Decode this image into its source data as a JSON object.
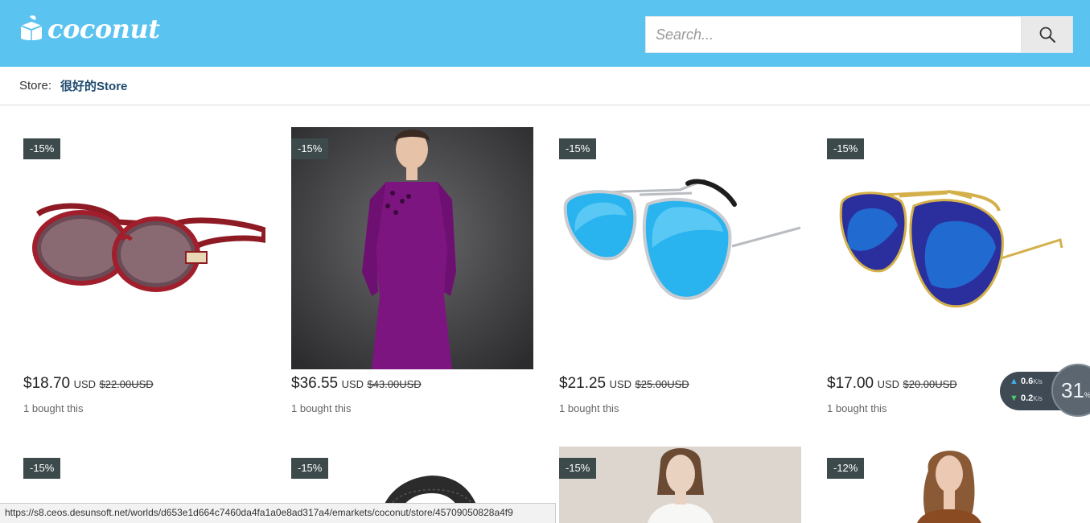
{
  "header": {
    "logo_text": "coconut",
    "search_placeholder": "Search..."
  },
  "store_bar": {
    "label": "Store:",
    "name": "很好的Store"
  },
  "products": [
    {
      "discount": "-15%",
      "price": "$18.70",
      "currency": "USD",
      "old_price": "$22.00USD",
      "bought": "1  bought this",
      "image": "red-sunglasses"
    },
    {
      "discount": "-15%",
      "price": "$36.55",
      "currency": "USD",
      "old_price": "$43.00USD",
      "bought": "1  bought this",
      "image": "purple-dress"
    },
    {
      "discount": "-15%",
      "price": "$21.25",
      "currency": "USD",
      "old_price": "$25.00USD",
      "bought": "1  bought this",
      "image": "blue-mirror-aviators"
    },
    {
      "discount": "-15%",
      "price": "$17.00",
      "currency": "USD",
      "old_price": "$20.00USD",
      "bought": "1  bought this",
      "image": "gold-blue-aviators"
    },
    {
      "discount": "-15%",
      "image": "blank"
    },
    {
      "discount": "-15%",
      "image": "leather-belt"
    },
    {
      "discount": "-15%",
      "image": "woman-white-blouse"
    },
    {
      "discount": "-12%",
      "image": "woman-brown-top"
    }
  ],
  "status_url": "https://s8.ceos.desunsoft.net/worlds/d653e1d664c7460da4fa1a0e8ad317a4/emarkets/coconut/store/45709050828a4f9",
  "net_widget": {
    "upload": "0.6",
    "download": "0.2",
    "unit": "K/s",
    "percent": "31",
    "percent_unit": "%"
  },
  "colors": {
    "header_bg": "#5bc3ef",
    "badge_bg": "#3c4a4c",
    "store_name": "#1d4a6f"
  }
}
